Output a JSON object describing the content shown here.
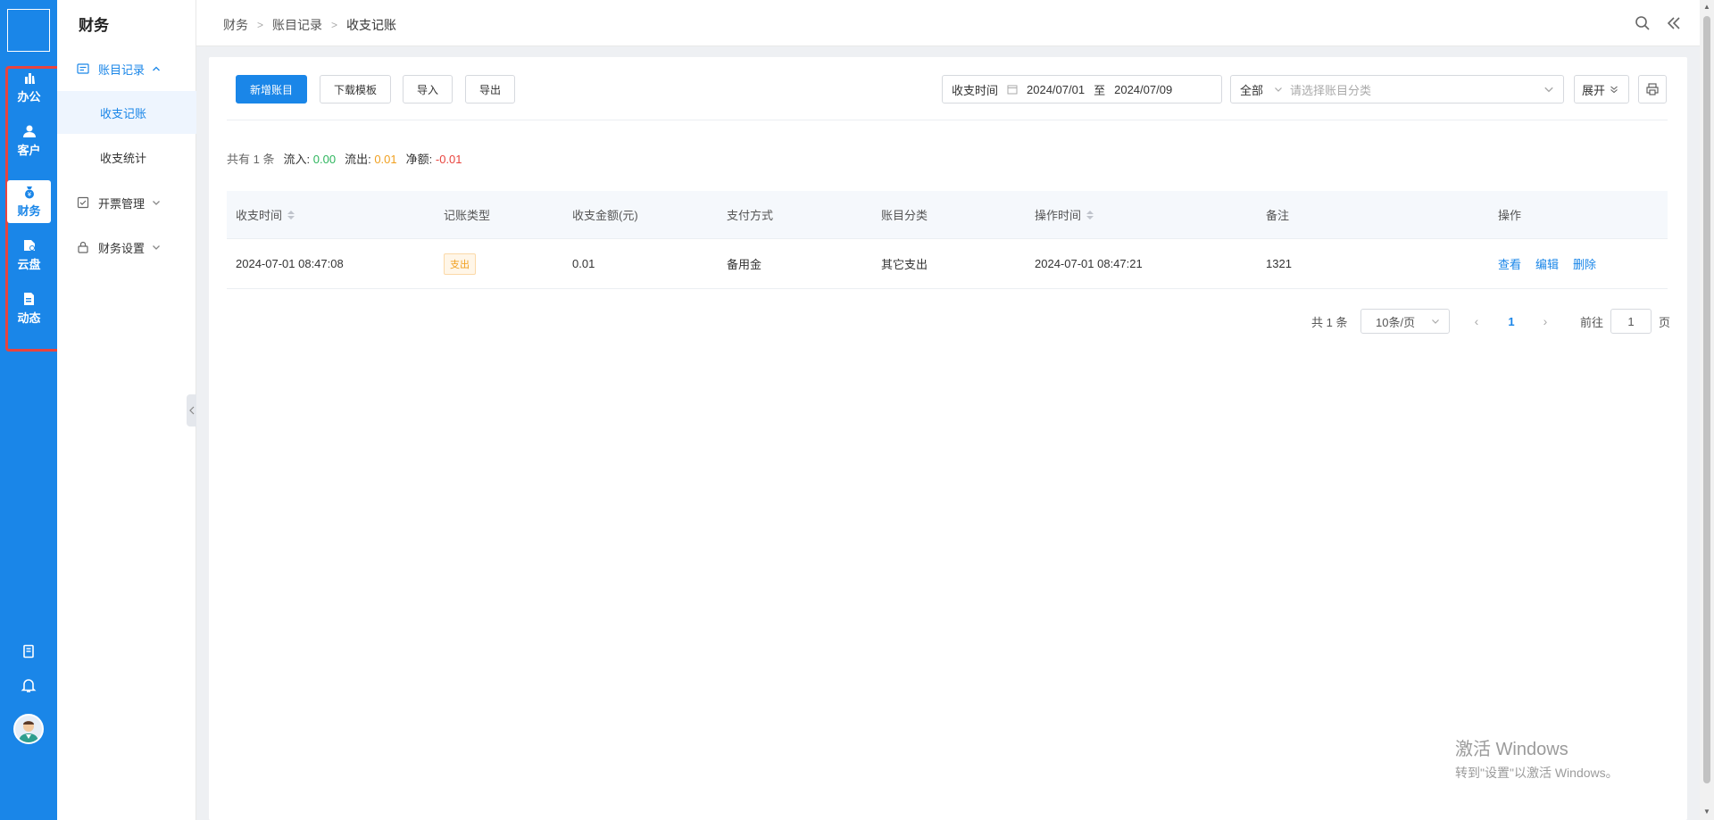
{
  "rail": {
    "items": [
      {
        "label": "办公",
        "icon": "office-icon"
      },
      {
        "label": "客户",
        "icon": "customer-icon"
      },
      {
        "label": "财务",
        "icon": "finance-icon"
      },
      {
        "label": "云盘",
        "icon": "cloud-disk-icon"
      },
      {
        "label": "动态",
        "icon": "activity-icon"
      }
    ],
    "active": "财务",
    "bottom_icons": [
      "book-icon",
      "bell-icon",
      "avatar"
    ],
    "accent_color": "#1a86e8",
    "highlight_color": "#e8443e"
  },
  "sidebar": {
    "title": "财务",
    "groups": [
      {
        "label": "账目记录",
        "icon": "ledger-icon",
        "expanded": true,
        "children": [
          {
            "label": "收支记账",
            "active": true
          },
          {
            "label": "收支统计"
          }
        ]
      },
      {
        "label": "开票管理",
        "icon": "checkbox-icon",
        "expanded": false
      },
      {
        "label": "财务设置",
        "icon": "lock-icon",
        "expanded": false
      }
    ]
  },
  "breadcrumb": [
    "财务",
    "账目记录",
    "收支记账"
  ],
  "toolbar": {
    "add_label": "新增账目",
    "template_label": "下载模板",
    "import_label": "导入",
    "export_label": "导出",
    "date_label": "收支时间",
    "date_start": "2024/07/01",
    "date_sep": "至",
    "date_end": "2024/07/09",
    "type_value": "全部",
    "category_placeholder": "请选择账目分类",
    "expand_label": "展开"
  },
  "summary": {
    "total_prefix": "共有",
    "total_count": "1",
    "total_suffix": "条",
    "inflow_label": "流入:",
    "inflow": "0.00",
    "outflow_label": "流出:",
    "outflow": "0.01",
    "net_label": "净额:",
    "net": "-0.01"
  },
  "table": {
    "columns": [
      "收支时间",
      "记账类型",
      "收支金额(元)",
      "支付方式",
      "账目分类",
      "操作时间",
      "备注",
      "操作"
    ],
    "rows": [
      {
        "time": "2024-07-01 08:47:08",
        "type": "支出",
        "amount": "0.01",
        "method": "备用金",
        "category": "其它支出",
        "op_time": "2024-07-01 08:47:21",
        "note": "1321",
        "actions": [
          "查看",
          "编辑",
          "删除"
        ]
      }
    ]
  },
  "pagination": {
    "total": "共 1 条",
    "page_size": "10条/页",
    "current": "1",
    "goto_label": "前往",
    "goto_value": "1",
    "page_suffix": "页"
  },
  "watermark": {
    "line1": "激活 Windows",
    "line2": "转到\"设置\"以激活 Windows。"
  }
}
